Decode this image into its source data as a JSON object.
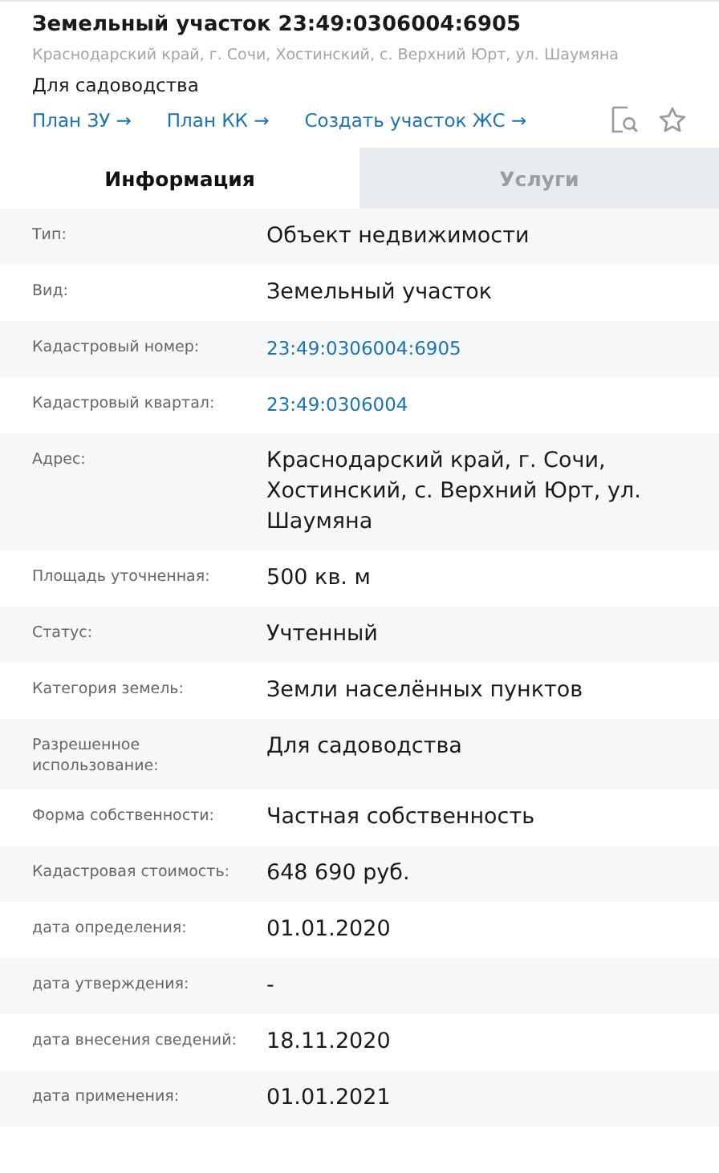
{
  "header": {
    "title": "Земельный участок 23:49:0306004:6905",
    "address": "Краснодарский край, г. Сочи, Хостинский, с. Верхний Юрт, ул. Шаумяна",
    "purpose": "Для садоводства",
    "links": [
      "План ЗУ →",
      "План КК →",
      "Создать участок ЖС →"
    ]
  },
  "tabs": [
    {
      "label": "Информация",
      "selected": true
    },
    {
      "label": "Услуги",
      "selected": false
    }
  ],
  "rows": [
    {
      "label": "Тип:",
      "value": "Объект недвижимости",
      "kind": "text"
    },
    {
      "label": "Вид:",
      "value": "Земельный участок",
      "kind": "text"
    },
    {
      "label": "Кадастровый номер:",
      "value": "23:49:0306004:6905",
      "kind": "link"
    },
    {
      "label": "Кадастровый квартал:",
      "value": "23:49:0306004",
      "kind": "link"
    },
    {
      "label": "Адрес:",
      "value": "Краснодарский край, г. Сочи, Хостинский, с. Верхний Юрт, ул. Шаумяна",
      "kind": "text"
    },
    {
      "label": "Площадь уточненная:",
      "value": "500 кв. м",
      "kind": "text"
    },
    {
      "label": "Статус:",
      "value": "Учтенный",
      "kind": "text"
    },
    {
      "label": "Категория земель:",
      "value": "Земли населённых пунктов",
      "kind": "text"
    },
    {
      "label": "Разрешенное использование:",
      "value": "Для садоводства",
      "kind": "text"
    },
    {
      "label": "Форма собственности:",
      "value": "Частная собственность",
      "kind": "text"
    },
    {
      "label": "Кадастровая стоимость:",
      "value": "648 690 руб.",
      "kind": "text"
    },
    {
      "label": "дата определения:",
      "value": "01.01.2020",
      "kind": "text"
    },
    {
      "label": "дата утверждения:",
      "value": "-",
      "kind": "text"
    },
    {
      "label": "дата внесения сведений:",
      "value": "18.11.2020",
      "kind": "text"
    },
    {
      "label": "дата применения:",
      "value": "01.01.2021",
      "kind": "text"
    }
  ]
}
